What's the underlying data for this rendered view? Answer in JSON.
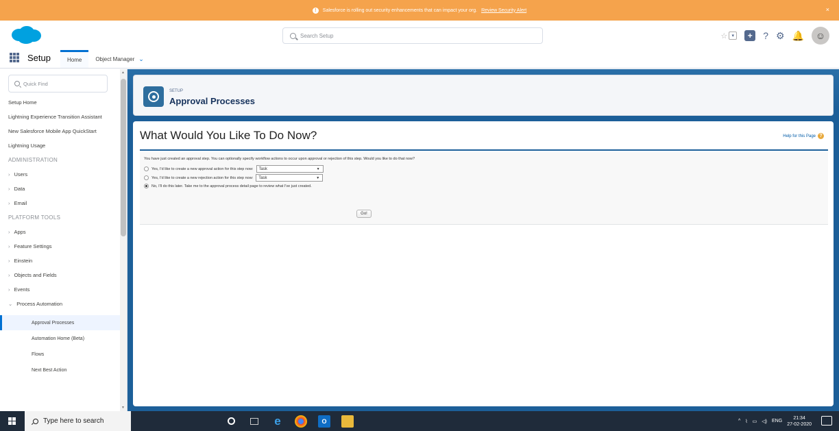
{
  "banner": {
    "message": "Salesforce is rolling out security enhancements that can impact your org.",
    "link": "Review Security Alert",
    "close": "×"
  },
  "header": {
    "search_placeholder": "Search Setup",
    "help": "?",
    "gear": "⚙",
    "bell": "🔔"
  },
  "nav": {
    "app_title": "Setup",
    "tabs": [
      {
        "label": "Home"
      },
      {
        "label": "Object Manager"
      }
    ]
  },
  "sidebar": {
    "quick_find_placeholder": "Quick Find",
    "top_items": [
      "Setup Home",
      "Lightning Experience Transition Assistant",
      "New Salesforce Mobile App QuickStart",
      "Lightning Usage"
    ],
    "admin_heading": "ADMINISTRATION",
    "admin_items": [
      "Users",
      "Data",
      "Email"
    ],
    "platform_heading": "PLATFORM TOOLS",
    "platform_items": [
      "Apps",
      "Feature Settings",
      "Einstein",
      "Objects and Fields",
      "Events"
    ],
    "expanded_group": "Process Automation",
    "sub_items": [
      "Approval Processes",
      "Automation Home (Beta)",
      "Flows",
      "Next Best Action"
    ]
  },
  "page_header": {
    "eyebrow": "SETUP",
    "title": "Approval Processes"
  },
  "content": {
    "title": "What Would You Like To Do Now?",
    "help_link": "Help for this Page",
    "intro": "You have just created an approval step. You can optionally specify workflow actions to occur upon approval or rejection of this step. Would you like to do that now?",
    "options": [
      {
        "label": "Yes, I'd like to create a new approval action for this step now:",
        "select": "Task",
        "checked": false
      },
      {
        "label": "Yes, I'd like to create a new rejection action for this step now:",
        "select": "Task",
        "checked": false
      },
      {
        "label": "No, I'll do this later. Take me to the approval process detail page to review what I've just created.",
        "checked": true
      }
    ],
    "go_button": "Go!"
  },
  "taskbar": {
    "search_placeholder": "Type here to search",
    "lang": "ENG",
    "time": "21:34",
    "date": "27-02-2020"
  }
}
